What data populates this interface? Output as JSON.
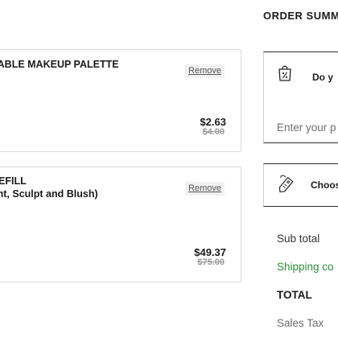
{
  "cart": {
    "items": [
      {
        "name_lines": [
          "LABLE MAKEUP PALETTE"
        ],
        "remove_label": "Remove",
        "price": "$2.63",
        "original_price": "$4.00"
      },
      {
        "name_lines": [
          "REFILL",
          "ght, Sculpt and Blush)"
        ],
        "remove_label": "Remove",
        "price": "$49.37",
        "original_price": "$75.00"
      }
    ]
  },
  "summary": {
    "heading": "ORDER SUMM",
    "promo": {
      "icon": "shopping-bag-percent-icon",
      "prompt": "Do y",
      "input_placeholder": "Enter your p"
    },
    "shipping_selector": {
      "icon": "price-tag-icon",
      "label": "Choos"
    },
    "rows": {
      "subtotal_label": "Sub total",
      "shipping_label": "Shipping co",
      "total_label": "TOTAL",
      "tax_label": "Sales Tax"
    }
  },
  "colors": {
    "shipping_green": "#2e8b3a",
    "strike_gray": "#9a9a9a",
    "border_dark": "#2b2b2b"
  }
}
